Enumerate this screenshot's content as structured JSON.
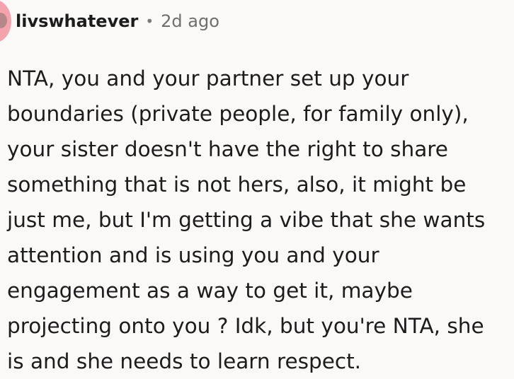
{
  "comment": {
    "author": "livswhatever",
    "separator": "•",
    "time": "2d ago",
    "body": "NTA, you and your partner set up your\nboundaries (private people, for family only),\nyour sister doesn't have the right to share\nsomething that is not hers, also, it might be\njust me, but I'm getting a vibe that she wants\nattention and is using you and your\nengagement as a way to get it, maybe\nprojecting onto you ? Idk, but you're NTA, she\nis and she needs to learn respect.",
    "avatar_color": "#f4a3ad"
  }
}
